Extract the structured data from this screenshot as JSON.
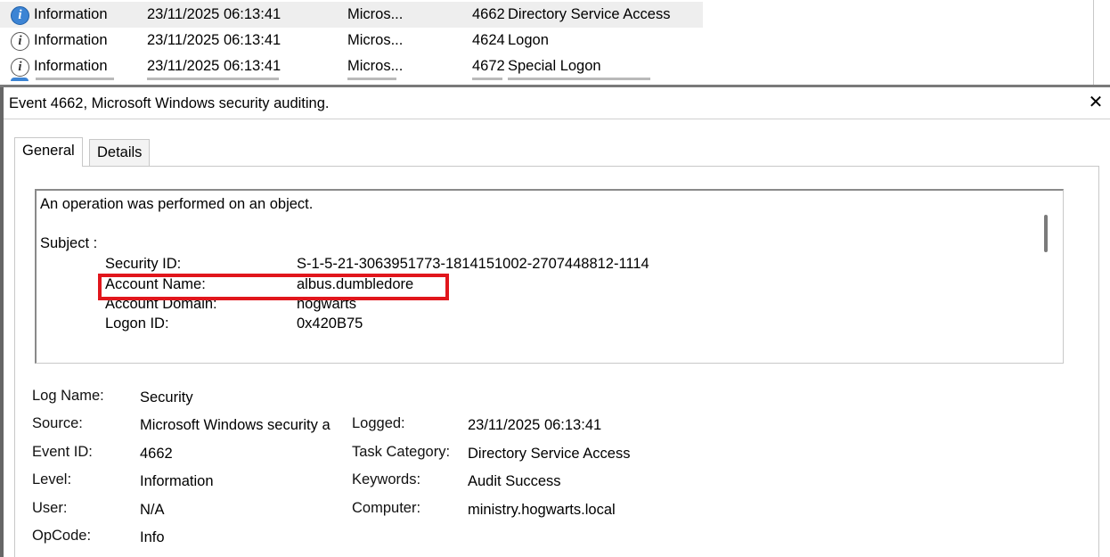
{
  "event_list": {
    "rows": [
      {
        "level": "Information",
        "date": "23/11/2025 06:13:41",
        "source": "Micros...",
        "event_id": "4662",
        "task": "Directory Service Access",
        "selected": true
      },
      {
        "level": "Information",
        "date": "23/11/2025 06:13:41",
        "source": "Micros...",
        "event_id": "4624",
        "task": "Logon",
        "selected": false
      },
      {
        "level": "Information",
        "date": "23/11/2025 06:13:41",
        "source": "Micros...",
        "event_id": "4672",
        "task": "Special Logon",
        "selected": false
      }
    ]
  },
  "details": {
    "title": "Event 4662, Microsoft Windows security auditing.",
    "close_icon": "close-icon",
    "tabs": [
      {
        "label": "General",
        "active": true
      },
      {
        "label": "Details",
        "active": false
      }
    ],
    "description": {
      "intro": "An operation was performed on an object.",
      "subject_header": "Subject :",
      "fields": [
        {
          "label": "Security ID:",
          "value": "S-1-5-21-3063951773-1814151002-2707448812-1114"
        },
        {
          "label": "Account Name:",
          "value": "albus.dumbledore"
        },
        {
          "label": "Account Domain:",
          "value": "hogwarts"
        },
        {
          "label": "Logon ID:",
          "value": "0x420B75"
        }
      ],
      "highlight_color": "#e1161c"
    },
    "properties": {
      "log_name": {
        "label": "Log Name:",
        "value": "Security"
      },
      "source": {
        "label": "Source:",
        "value": "Microsoft Windows security a"
      },
      "event_id": {
        "label": "Event ID:",
        "value": "4662"
      },
      "level": {
        "label": "Level:",
        "value": "Information"
      },
      "user": {
        "label": "User:",
        "value": "N/A"
      },
      "opcode": {
        "label": "OpCode:",
        "value": "Info"
      },
      "logged": {
        "label": "Logged:",
        "value": "23/11/2025 06:13:41"
      },
      "task_category": {
        "label": "Task Category:",
        "value": "Directory Service Access"
      },
      "keywords": {
        "label": "Keywords:",
        "value": "Audit Success"
      },
      "computer": {
        "label": "Computer:",
        "value": "ministry.hogwarts.local"
      }
    }
  }
}
